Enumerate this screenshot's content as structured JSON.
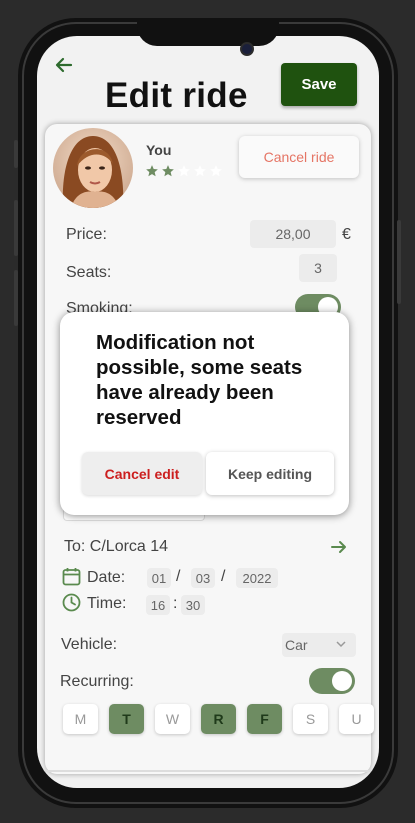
{
  "header": {
    "title": "Edit ride",
    "save_label": "Save"
  },
  "driver": {
    "name": "You",
    "rating": 2,
    "max_rating": 5
  },
  "cancel_ride_label": "Cancel ride",
  "price": {
    "label": "Price:",
    "value": "28,00",
    "currency": "€"
  },
  "seats": {
    "label": "Seats:",
    "value": "3"
  },
  "smoking": {
    "label": "Smoking:",
    "on": true
  },
  "destination": {
    "label": "To: C/Lorca 14"
  },
  "date": {
    "label": "Date:",
    "day": "01",
    "month": "03",
    "year": "2022",
    "sep": "/"
  },
  "time": {
    "label": "Time:",
    "hour": "16",
    "minute": "30",
    "sep": ":"
  },
  "vehicle": {
    "label": "Vehicle:",
    "value": "Car"
  },
  "recurring": {
    "label": "Recurring:",
    "on": true
  },
  "days": [
    {
      "label": "M",
      "active": false
    },
    {
      "label": "T",
      "active": true
    },
    {
      "label": "W",
      "active": false
    },
    {
      "label": "R",
      "active": true
    },
    {
      "label": "F",
      "active": true
    },
    {
      "label": "S",
      "active": false
    },
    {
      "label": "U",
      "active": false
    }
  ],
  "dialog": {
    "message": "Modification not possible, some seats have already been reserved",
    "cancel_label": "Cancel edit",
    "keep_label": "Keep editing"
  },
  "colors": {
    "accent": "#1f520f",
    "green": "#6e8c62",
    "danger": "#cc1f1f",
    "cancel_text": "#e57565"
  }
}
